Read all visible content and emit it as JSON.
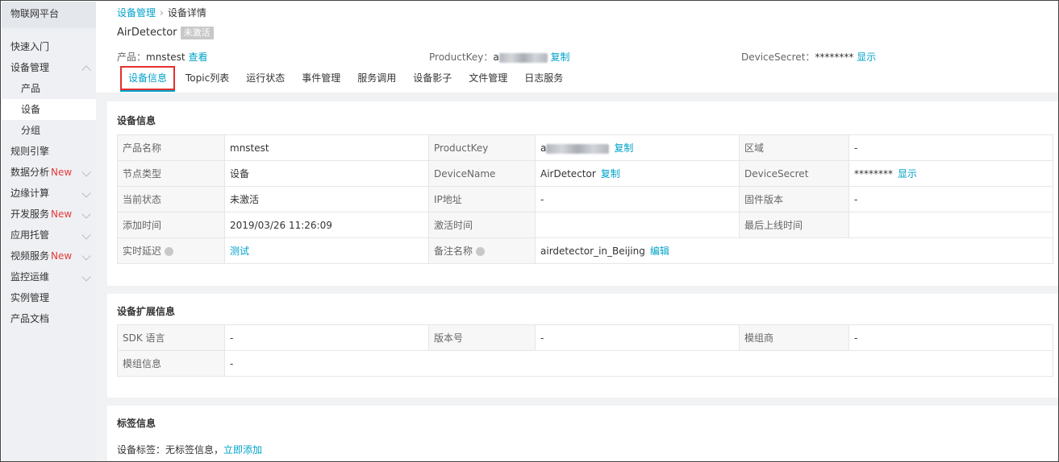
{
  "sidebar": {
    "title": "物联网平台",
    "items": [
      {
        "label": "快速入门",
        "sub": false,
        "chev": "",
        "new": ""
      },
      {
        "label": "设备管理",
        "sub": false,
        "chev": "up",
        "new": ""
      },
      {
        "label": "产品",
        "sub": true,
        "chev": "",
        "new": ""
      },
      {
        "label": "设备",
        "sub": true,
        "chev": "",
        "new": "",
        "active": true
      },
      {
        "label": "分组",
        "sub": true,
        "chev": "",
        "new": ""
      },
      {
        "label": "规则引擎",
        "sub": false,
        "chev": "",
        "new": ""
      },
      {
        "label": "数据分析",
        "sub": false,
        "chev": "down",
        "new": "New"
      },
      {
        "label": "边缘计算",
        "sub": false,
        "chev": "down",
        "new": ""
      },
      {
        "label": "开发服务",
        "sub": false,
        "chev": "down",
        "new": "New"
      },
      {
        "label": "应用托管",
        "sub": false,
        "chev": "down",
        "new": ""
      },
      {
        "label": "视频服务",
        "sub": false,
        "chev": "down",
        "new": "New"
      },
      {
        "label": "监控运维",
        "sub": false,
        "chev": "down",
        "new": ""
      },
      {
        "label": "实例管理",
        "sub": false,
        "chev": "",
        "new": ""
      },
      {
        "label": "产品文档",
        "sub": false,
        "chev": "",
        "new": ""
      }
    ]
  },
  "breadcrumb": {
    "parent": "设备管理",
    "current": "设备详情"
  },
  "device": {
    "name": "AirDetector",
    "status": "未激活",
    "product_label": "产品：",
    "product_value": "mnstest",
    "product_link": "查看",
    "productkey_label": "ProductKey：",
    "productkey_prefix": "a",
    "productkey_link": "复制",
    "devicesecret_label": "DeviceSecret：",
    "devicesecret_value": "********",
    "devicesecret_link": "显示"
  },
  "tabs": [
    "设备信息",
    "Topic列表",
    "运行状态",
    "事件管理",
    "服务调用",
    "设备影子",
    "文件管理",
    "日志服务"
  ],
  "info": {
    "title": "设备信息",
    "rows": [
      {
        "c": [
          {
            "t": "k",
            "v": "产品名称"
          },
          {
            "t": "v",
            "v": "mnstest"
          },
          {
            "t": "k",
            "v": "ProductKey"
          },
          {
            "t": "v",
            "v": "a",
            "blur": true,
            "link": "复制"
          },
          {
            "t": "k",
            "v": "区域"
          },
          {
            "t": "v",
            "v": "-"
          }
        ]
      },
      {
        "c": [
          {
            "t": "k",
            "v": "节点类型"
          },
          {
            "t": "v",
            "v": "设备"
          },
          {
            "t": "k",
            "v": "DeviceName"
          },
          {
            "t": "v",
            "v": "AirDetector",
            "link": "复制"
          },
          {
            "t": "k",
            "v": "DeviceSecret"
          },
          {
            "t": "v",
            "v": "********",
            "link": "显示"
          }
        ]
      },
      {
        "c": [
          {
            "t": "k",
            "v": "当前状态"
          },
          {
            "t": "v",
            "v": "未激活"
          },
          {
            "t": "k",
            "v": "IP地址"
          },
          {
            "t": "v",
            "v": "-"
          },
          {
            "t": "k",
            "v": "固件版本"
          },
          {
            "t": "v",
            "v": "-"
          }
        ]
      },
      {
        "c": [
          {
            "t": "k",
            "v": "添加时间"
          },
          {
            "t": "v",
            "v": "2019/03/26 11:26:09"
          },
          {
            "t": "k",
            "v": "激活时间"
          },
          {
            "t": "v",
            "v": ""
          },
          {
            "t": "k",
            "v": "最后上线时间"
          },
          {
            "t": "v",
            "v": ""
          }
        ]
      },
      {
        "c": [
          {
            "t": "k",
            "v": "实时延迟",
            "help": true
          },
          {
            "t": "v",
            "v": "",
            "link": "测试"
          },
          {
            "t": "k",
            "v": "备注名称",
            "help": true
          },
          {
            "t": "v",
            "v": "airdetector_in_Beijing",
            "link": "编辑",
            "span": 3
          }
        ]
      }
    ]
  },
  "ext": {
    "title": "设备扩展信息",
    "rows": [
      {
        "c": [
          {
            "t": "k",
            "v": "SDK 语言"
          },
          {
            "t": "v",
            "v": "-"
          },
          {
            "t": "k",
            "v": "版本号"
          },
          {
            "t": "v",
            "v": "-"
          },
          {
            "t": "k",
            "v": "模组商"
          },
          {
            "t": "v",
            "v": "-"
          }
        ]
      },
      {
        "c": [
          {
            "t": "k",
            "v": "模组信息"
          },
          {
            "t": "v",
            "v": "-",
            "span": 5
          }
        ]
      }
    ]
  },
  "tags": {
    "title": "标签信息",
    "label": "设备标签：无标签信息，",
    "link": "立即添加"
  }
}
